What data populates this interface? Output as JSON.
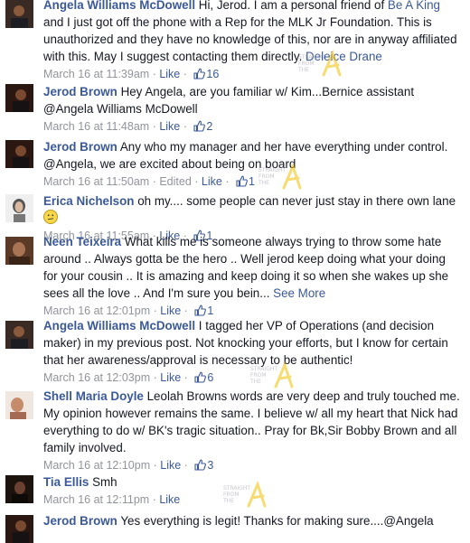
{
  "comments": [
    {
      "author": "Angela Williams McDowell",
      "text_before": " Hi, Jerod. I am a personal friend of ",
      "link1": "Be A King",
      "text_mid": " and I just got off the phone with a Rep for the MLK Jr Foundation. This is unauthorized and they have no knowledge of this, nor are in anyway affiliated with this. May I suggest contacting them directly. ",
      "link2": "Deleice Drane",
      "timestamp": "March 16 at 11:39am",
      "like_label": "Like",
      "like_count": "16"
    },
    {
      "author": "Jerod Brown",
      "text": " Hey Angela, are you familiar w/ Kim...Bernice assistant @Angela Williams McDowell",
      "timestamp": "March 16 at 11:48am",
      "like_label": "Like",
      "like_count": "2"
    },
    {
      "author": "Jerod Brown",
      "text": " Any who my manager and her have everything under control. @Angela, we are excited about being on board",
      "timestamp": "March 16 at 11:50am",
      "edited": "Edited",
      "like_label": "Like",
      "like_count": "1"
    },
    {
      "author": "Erica Nichelson",
      "text": " oh my.... some people can never just stay in there own lane",
      "timestamp": "March 16 at 11:55am",
      "like_label": "Like",
      "like_count": "1"
    },
    {
      "author": "Neen Teixeira",
      "text": " What kills me is someone always trying to throw some hate around .. Always gotta be the hero .. Well jerod keep doing what your doing for your cousin .. It is amazing and keep doing it so when she wakes up she sees all the love .. And I'm sure you bein... ",
      "see_more": "See More",
      "timestamp": "March 16 at 12:01pm",
      "like_label": "Like",
      "like_count": "1"
    },
    {
      "author": "Angela Williams McDowell",
      "text": " I tagged her VP of Operations (and decision maker) in my previous post. Not knocking your efforts, but I know for certain that her awareness/approval is necessary to be authentic!",
      "timestamp": "March 16 at 12:03pm",
      "like_label": "Like",
      "like_count": "6"
    },
    {
      "author": "Shell Maria Doyle",
      "text": " Leolah Browns words are very deep and truly touched me. My opinion however remains the same. I believe w/ all my heart that Nick had everything to do w/ BK's tragic situation.. Pray for Bk,Sir Bobby Brown and all family involved.",
      "timestamp": "March 16 at 12:10pm",
      "like_label": "Like",
      "like_count": "3"
    },
    {
      "author": "Tia Ellis",
      "text": " Smh",
      "timestamp": "March 16 at 12:11pm",
      "like_label": "Like"
    },
    {
      "author": "Jerod Brown",
      "text": " Yes everything is legit! Thanks for making sure....@Angela"
    }
  ],
  "watermark": {
    "line1": "STRAIGHT",
    "line2": "FROM",
    "line3": "THE"
  },
  "colors": {
    "link": "#3b5998",
    "meta": "#90949c",
    "text": "#141823"
  }
}
